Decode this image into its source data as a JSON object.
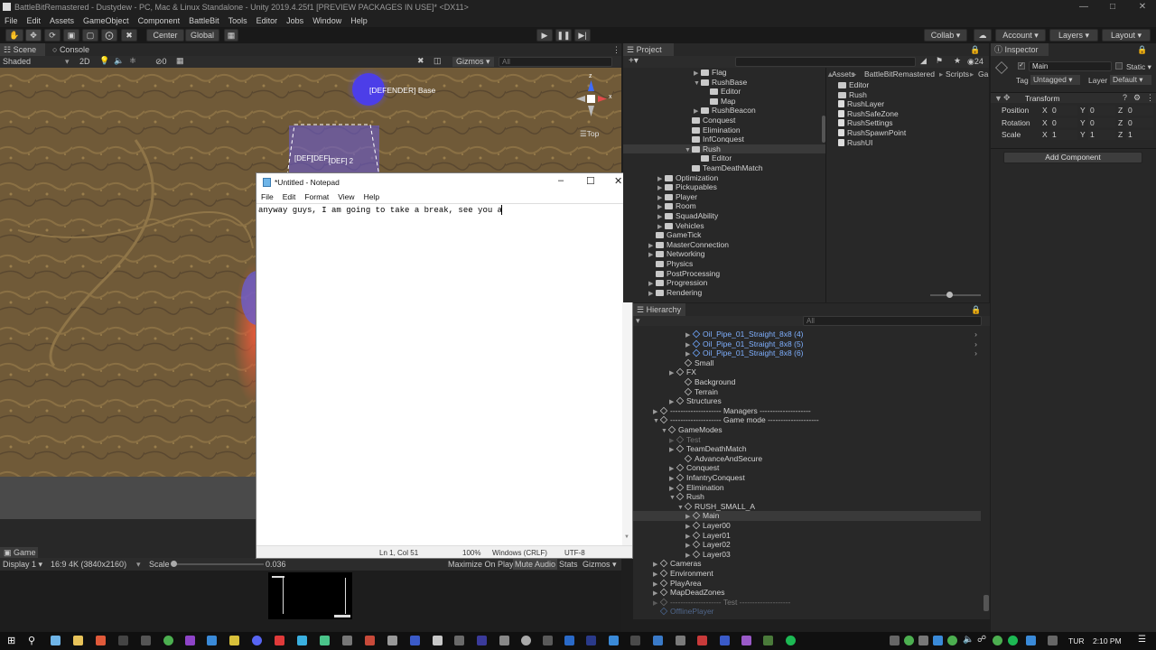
{
  "window": {
    "title": "BattleBitRemastered - Dustydew - PC, Mac & Linux Standalone - Unity 2019.4.25f1 [PREVIEW PACKAGES IN USE]* <DX11>"
  },
  "menu": [
    "File",
    "Edit",
    "Assets",
    "GameObject",
    "Component",
    "BattleBit",
    "Tools",
    "Editor",
    "Jobs",
    "Window",
    "Help"
  ],
  "toolbar": {
    "center": "Center",
    "global": "Global",
    "collab": "Collab",
    "account": "Account",
    "layers": "Layers",
    "layout": "Layout"
  },
  "scene": {
    "tab_scene": "Scene",
    "tab_console": "Console",
    "shading": "Shaded",
    "mode_2d": "2D",
    "fx_count": "0",
    "gizmos": "Gizmos",
    "search_placeholder": "All",
    "orientation": "Top",
    "label_defender_base": "[DEFENDER] Base",
    "label_def1": "[DEF]",
    "label_def_mid": "[DEF]",
    "label_def2": "[DEF] 2"
  },
  "game": {
    "tab": "Game",
    "display": "Display 1",
    "aspect": "16:9 4K (3840x2160)",
    "scale_label": "Scale",
    "scale_value": "0.036",
    "maximize": "Maximize On Play",
    "mute": "Mute Audio",
    "stats": "Stats",
    "gizmos": "Gizmos"
  },
  "notepad": {
    "title": "*Untitled - Notepad",
    "menu": [
      "File",
      "Edit",
      "Format",
      "View",
      "Help"
    ],
    "text": "anyway guys, I am going to take a break, see you a",
    "status_pos": "Ln 1, Col 51",
    "status_zoom": "100%",
    "status_eol": "Windows (CRLF)",
    "status_enc": "UTF-8"
  },
  "project": {
    "tab": "Project",
    "count": "24",
    "breadcrumb": [
      "Assets",
      "BattleBitRemastered",
      "Scripts",
      "Ga"
    ],
    "tree": [
      {
        "label": "Flag",
        "indent": 8,
        "arrow": "▶"
      },
      {
        "label": "RushBase",
        "indent": 8,
        "arrow": "▼"
      },
      {
        "label": "Editor",
        "indent": 9,
        "arrow": ""
      },
      {
        "label": "Map",
        "indent": 9,
        "arrow": ""
      },
      {
        "label": "RushBeacon",
        "indent": 8,
        "arrow": "▶"
      },
      {
        "label": "Conquest",
        "indent": 7,
        "arrow": ""
      },
      {
        "label": "Elimination",
        "indent": 7,
        "arrow": ""
      },
      {
        "label": "InfConquest",
        "indent": 7,
        "arrow": ""
      },
      {
        "label": "Rush",
        "indent": 7,
        "arrow": "▼",
        "selected": true
      },
      {
        "label": "Editor",
        "indent": 8,
        "arrow": ""
      },
      {
        "label": "TeamDeathMatch",
        "indent": 7,
        "arrow": ""
      },
      {
        "label": "Optimization",
        "indent": 4,
        "arrow": "▶"
      },
      {
        "label": "Pickupables",
        "indent": 4,
        "arrow": "▶"
      },
      {
        "label": "Player",
        "indent": 4,
        "arrow": "▶"
      },
      {
        "label": "Room",
        "indent": 4,
        "arrow": "▶"
      },
      {
        "label": "SquadAbility",
        "indent": 4,
        "arrow": "▶"
      },
      {
        "label": "Vehicles",
        "indent": 4,
        "arrow": "▶"
      },
      {
        "label": "GameTick",
        "indent": 3,
        "arrow": ""
      },
      {
        "label": "MasterConnection",
        "indent": 3,
        "arrow": "▶"
      },
      {
        "label": "Networking",
        "indent": 3,
        "arrow": "▶"
      },
      {
        "label": "Physics",
        "indent": 3,
        "arrow": ""
      },
      {
        "label": "PostProcessing",
        "indent": 3,
        "arrow": ""
      },
      {
        "label": "Progression",
        "indent": 3,
        "arrow": "▶"
      },
      {
        "label": "Rendering",
        "indent": 3,
        "arrow": "▶"
      }
    ],
    "files": [
      {
        "label": "Editor",
        "kind": "folder"
      },
      {
        "label": "Rush",
        "kind": "folder"
      },
      {
        "label": "RushLayer",
        "kind": "script"
      },
      {
        "label": "RushSafeZone",
        "kind": "script"
      },
      {
        "label": "RushSettings",
        "kind": "script"
      },
      {
        "label": "RushSpawnPoint",
        "kind": "script"
      },
      {
        "label": "RushUI",
        "kind": "script"
      }
    ]
  },
  "inspector": {
    "tab": "Inspector",
    "object_name": "Main",
    "static": "Static",
    "tag_label": "Tag",
    "tag_value": "Untagged",
    "layer_label": "Layer",
    "layer_value": "Default",
    "component": "Transform",
    "position_label": "Position",
    "rotation_label": "Rotation",
    "scale_label": "Scale",
    "position": [
      "0",
      "0",
      "0"
    ],
    "rotation": [
      "0",
      "0",
      "0"
    ],
    "scale": [
      "1",
      "1",
      "1"
    ],
    "axes": [
      "X",
      "Y",
      "Z"
    ],
    "add_component": "Add Component"
  },
  "hierarchy": {
    "tab": "Hierarchy",
    "search_placeholder": "All",
    "rows": [
      {
        "label": "Oil_Pipe_01_Straight_8x8 (4)",
        "indent": 6,
        "arrow": "▶",
        "blue": true
      },
      {
        "label": "Oil_Pipe_01_Straight_8x8 (5)",
        "indent": 6,
        "arrow": "▶",
        "blue": true
      },
      {
        "label": "Oil_Pipe_01_Straight_8x8 (6)",
        "indent": 6,
        "arrow": "▶",
        "blue": true
      },
      {
        "label": "Small",
        "indent": 5,
        "arrow": ""
      },
      {
        "label": "FX",
        "indent": 4,
        "arrow": "▶"
      },
      {
        "label": "Background",
        "indent": 5,
        "arrow": ""
      },
      {
        "label": "Terrain",
        "indent": 5,
        "arrow": ""
      },
      {
        "label": "Structures",
        "indent": 4,
        "arrow": "▶"
      },
      {
        "label": "-------------------- Managers --------------------",
        "indent": 2,
        "arrow": "▶"
      },
      {
        "label": "-------------------- Game mode --------------------",
        "indent": 2,
        "arrow": "▼"
      },
      {
        "label": "GameModes",
        "indent": 3,
        "arrow": "▼"
      },
      {
        "label": "Test",
        "indent": 4,
        "arrow": "▶",
        "dim": true
      },
      {
        "label": "TeamDeathMatch",
        "indent": 4,
        "arrow": "▶"
      },
      {
        "label": "AdvanceAndSecure",
        "indent": 5,
        "arrow": ""
      },
      {
        "label": "Conquest",
        "indent": 4,
        "arrow": "▶"
      },
      {
        "label": "InfantryConquest",
        "indent": 4,
        "arrow": "▶"
      },
      {
        "label": "Elimination",
        "indent": 4,
        "arrow": "▶"
      },
      {
        "label": "Rush",
        "indent": 4,
        "arrow": "▼"
      },
      {
        "label": "RUSH_SMALL_A",
        "indent": 5,
        "arrow": "▼"
      },
      {
        "label": "Main",
        "indent": 6,
        "arrow": "▶",
        "selected": true
      },
      {
        "label": "Layer00",
        "indent": 6,
        "arrow": "▶"
      },
      {
        "label": "Layer01",
        "indent": 6,
        "arrow": "▶"
      },
      {
        "label": "Layer02",
        "indent": 6,
        "arrow": "▶"
      },
      {
        "label": "Layer03",
        "indent": 6,
        "arrow": "▶"
      },
      {
        "label": "Cameras",
        "indent": 2,
        "arrow": "▶"
      },
      {
        "label": "Environment",
        "indent": 2,
        "arrow": "▶"
      },
      {
        "label": "PlayArea",
        "indent": 2,
        "arrow": "▶"
      },
      {
        "label": "MapDeadZones",
        "indent": 2,
        "arrow": "▶"
      },
      {
        "label": "-------------------- Test --------------------",
        "indent": 2,
        "arrow": "▶",
        "dim": true
      },
      {
        "label": "OfflinePlayer",
        "indent": 2,
        "arrow": "",
        "blue": true,
        "dim": true
      }
    ]
  },
  "taskbar": {
    "lang": "TUR",
    "time": "2:10 PM"
  }
}
